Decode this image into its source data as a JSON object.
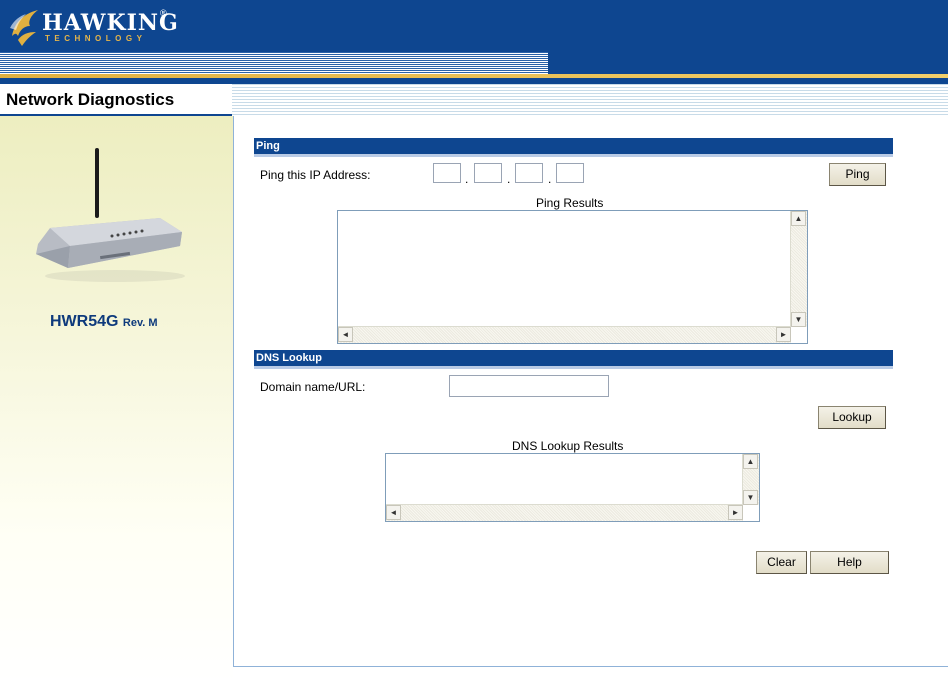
{
  "brand": {
    "name": "HAWKING",
    "tagline": "TECHNOLOGY",
    "registered": "®"
  },
  "page_title": "Network Diagnostics",
  "device": {
    "model": "HWR54G",
    "revision": "Rev. M"
  },
  "ping": {
    "section_title": "Ping",
    "ip_label": "Ping this IP Address:",
    "ip_octets": [
      "",
      "",
      "",
      ""
    ],
    "ip_separator": ".",
    "button_label": "Ping",
    "results_label": "Ping Results",
    "results_value": ""
  },
  "dns": {
    "section_title": "DNS Lookup",
    "domain_label": "Domain name/URL:",
    "domain_value": "",
    "button_label": "Lookup",
    "results_label": "DNS Lookup Results",
    "results_value": ""
  },
  "actions": {
    "clear_label": "Clear",
    "help_label": "Help"
  },
  "scroll_glyphs": {
    "up": "▲",
    "down": "▼",
    "left": "◄",
    "right": "►"
  },
  "colors": {
    "brand_blue": "#0e4690",
    "accent_gold": "#e0b040",
    "sidebar_tint": "#f5f5d8"
  }
}
